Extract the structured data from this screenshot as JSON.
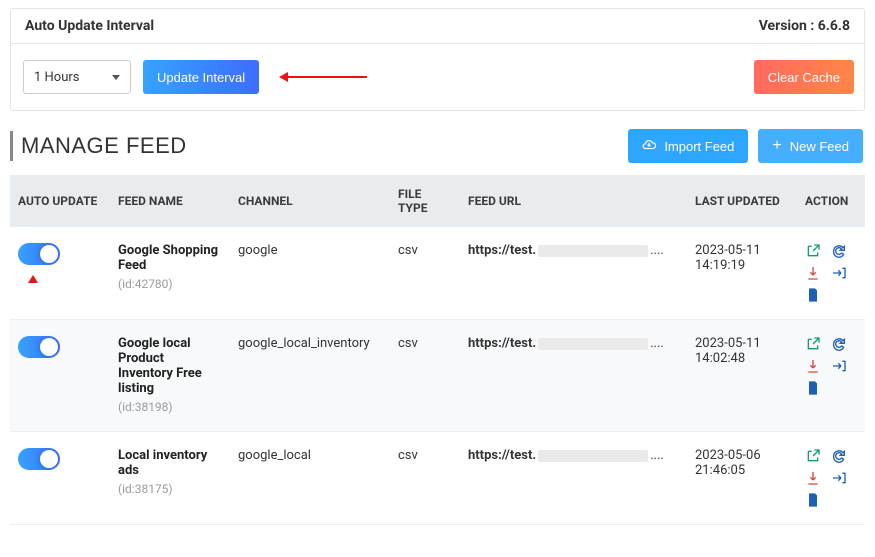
{
  "top": {
    "title": "Auto Update Interval",
    "version_label": "Version : 6.6.8",
    "interval_value": "1 Hours",
    "update_btn": "Update Interval",
    "clear_btn": "Clear Cache"
  },
  "section": {
    "title": "MANAGE FEED",
    "import_btn": "Import Feed",
    "new_btn": "New Feed"
  },
  "headers": {
    "auto": "AUTO UPDATE",
    "name": "FEED NAME",
    "channel": "CHANNEL",
    "ftype": "FILE TYPE",
    "url": "FEED URL",
    "updated": "LAST UPDATED",
    "action": "ACTION"
  },
  "rows": [
    {
      "name": "Google Shopping Feed",
      "id": "(id:42780)",
      "channel": "google",
      "ftype": "csv",
      "url_prefix": "https://test.",
      "url_suffix": "....",
      "updated": "2023-05-11 14:19:19",
      "arrow": true
    },
    {
      "name": "Google local Product Inventory Free listing",
      "id": "(id:38198)",
      "channel": "google_local_inventory",
      "ftype": "csv",
      "url_prefix": "https://test.",
      "url_suffix": "....",
      "updated": "2023-05-11 14:02:48",
      "arrow": false
    },
    {
      "name": "Local inventory ads",
      "id": "(id:38175)",
      "channel": "google_local",
      "ftype": "csv",
      "url_prefix": "https://test.",
      "url_suffix": "....",
      "updated": "2023-05-06 21:46:05",
      "arrow": false
    }
  ]
}
